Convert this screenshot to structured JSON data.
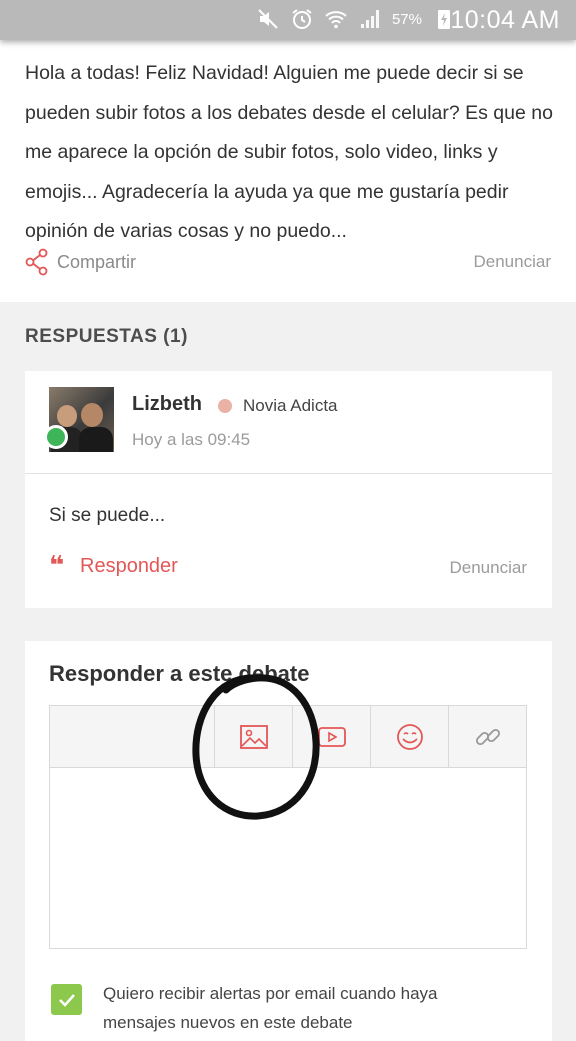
{
  "status_bar": {
    "battery_percent": "57%",
    "time": "10:04 AM",
    "icons": [
      "mute-icon",
      "alarm-icon",
      "wifi-icon",
      "signal-icon",
      "battery-icon"
    ]
  },
  "post": {
    "body": "Hola a todas! Feliz Navidad! Alguien me puede decir si se pueden subir fotos a los debates desde el celular? Es que no me aparece la opción de subir fotos, solo video, links y emojis... Agradecería la ayuda ya que me gustaría pedir opinión de varias cosas y no puedo...",
    "share_label": "Compartir",
    "report_label": "Denunciar"
  },
  "answers": {
    "title": "RESPUESTAS (1)",
    "items": [
      {
        "user": "Lizbeth",
        "rank": "Novia Adicta",
        "time": "Hoy a las 09:45",
        "text": "Si se puede...",
        "reply_label": "Responder",
        "report_label": "Denunciar"
      }
    ]
  },
  "reply_form": {
    "title": "Responder a este debate",
    "toolbar": [
      "image-icon",
      "video-icon",
      "emoji-icon",
      "link-icon"
    ],
    "editor_value": "",
    "alert_checked": true,
    "alert_label": "Quiero recibir alertas por email cuando haya mensajes nuevos en este debate"
  },
  "colors": {
    "accent": "#e35757",
    "online": "#3fb55a",
    "checkbox": "#8cc84b",
    "rank_dot": "#e9b2a4",
    "status_bar": "#b9b9b9"
  }
}
